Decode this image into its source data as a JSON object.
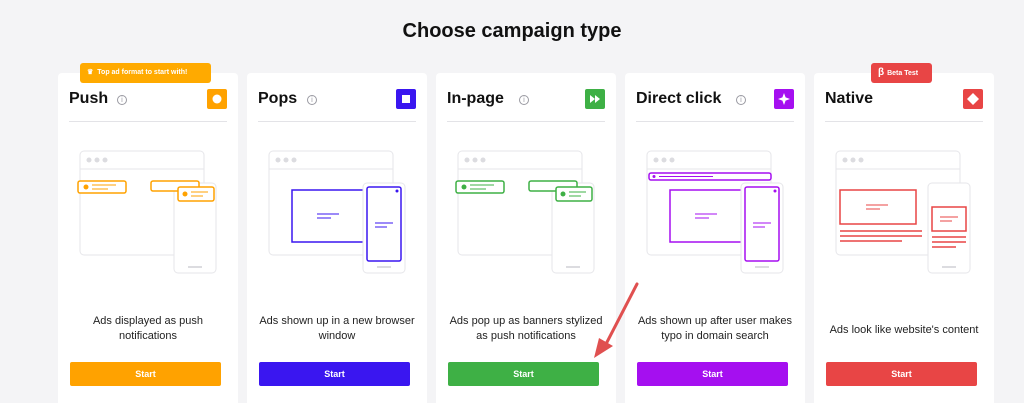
{
  "page": {
    "title": "Choose campaign type"
  },
  "badges": {
    "top_format": "Top ad format to start with!",
    "beta": "Beta Test",
    "beta_symbol": "β"
  },
  "colors": {
    "push": "#ffa200",
    "pops": "#3a16f0",
    "inpage": "#3eb045",
    "direct": "#a50ff0",
    "native": "#e84545",
    "background": "#f4f4f6",
    "arrow": "#e05050"
  },
  "cards": [
    {
      "title": "Push",
      "description": "Ads displayed as push notifications",
      "button": "Start",
      "icon": "circle-icon"
    },
    {
      "title": "Pops",
      "description": "Ads shown up in a new browser window",
      "button": "Start",
      "icon": "square-icon"
    },
    {
      "title": "In-page",
      "description": "Ads pop up as banners stylized as push notifications",
      "button": "Start",
      "icon": "fast-forward-icon"
    },
    {
      "title": "Direct click",
      "description": "Ads shown up after user makes typo in domain search",
      "button": "Start",
      "icon": "sparkle-icon"
    },
    {
      "title": "Native",
      "description": "Ads look like website's content",
      "button": "Start",
      "icon": "diamond-icon"
    }
  ]
}
